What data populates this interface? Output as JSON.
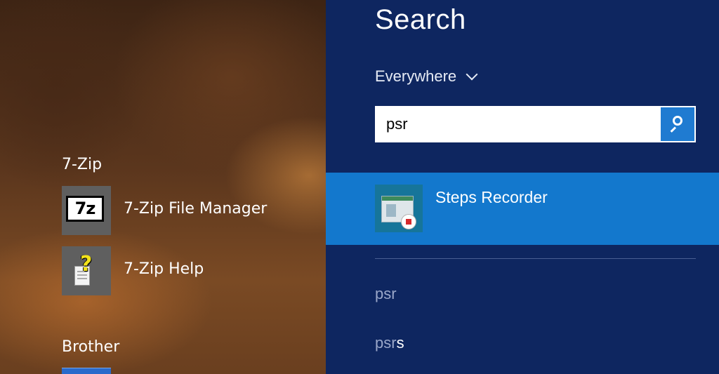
{
  "apps": {
    "groups": [
      {
        "header": "7-Zip",
        "items": [
          {
            "label": "7-Zip File Manager",
            "icon": "7zip-file-manager-icon",
            "logo_text": "7z"
          },
          {
            "label": "7-Zip Help",
            "icon": "help-document-icon"
          }
        ]
      },
      {
        "header": "Brother",
        "items": [
          {
            "label": "",
            "icon": "brother-app-icon"
          }
        ]
      }
    ]
  },
  "search": {
    "title": "Search",
    "scope": "Everywhere",
    "query": "psr",
    "button_icon": "search-icon",
    "results": [
      {
        "label": "Steps Recorder",
        "icon": "steps-recorder-icon"
      }
    ],
    "suggestions": [
      {
        "typed": "psr",
        "rest": ""
      },
      {
        "typed": "psr",
        "rest": "s"
      }
    ]
  },
  "colors": {
    "search_background": "#0e2660",
    "selected_result": "#1378cd",
    "search_button": "#1f7bd1"
  }
}
